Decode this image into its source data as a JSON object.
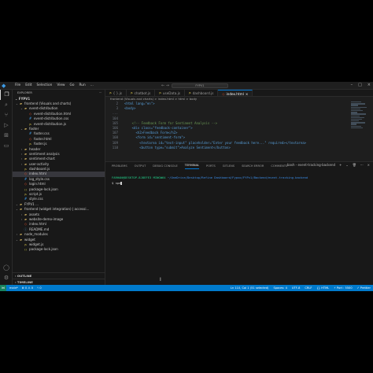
{
  "titlebar": {
    "menu": [
      "File",
      "Edit",
      "Selection",
      "View",
      "Go",
      "Run",
      "..."
    ],
    "search": "FYPV1"
  },
  "sidebar": {
    "header": "EXPLORER",
    "project": "FYPV1",
    "items": [
      {
        "label": "frontend (Visuals and charts)",
        "type": "folder",
        "depth": 0,
        "open": true
      },
      {
        "label": "event-distribution",
        "type": "folder",
        "depth": 1,
        "open": true
      },
      {
        "label": "event-distribution.html",
        "type": "html",
        "depth": 2
      },
      {
        "label": "event-distribution.css",
        "type": "css",
        "depth": 2
      },
      {
        "label": "event-distribution.js",
        "type": "js",
        "depth": 2
      },
      {
        "label": "footer",
        "type": "folder",
        "depth": 1,
        "open": true
      },
      {
        "label": "footer.css",
        "type": "css",
        "depth": 2
      },
      {
        "label": "footer.html",
        "type": "html",
        "depth": 2
      },
      {
        "label": "footer.js",
        "type": "js",
        "depth": 2
      },
      {
        "label": "header",
        "type": "folder",
        "depth": 1,
        "open": false
      },
      {
        "label": "sentiment analysis",
        "type": "folder",
        "depth": 1,
        "open": false
      },
      {
        "label": "sentiment-chart",
        "type": "folder",
        "depth": 1,
        "open": false
      },
      {
        "label": "user-activity",
        "type": "folder",
        "depth": 1,
        "open": false
      },
      {
        "label": "dashboard.js",
        "type": "js",
        "depth": 1
      },
      {
        "label": "index.html",
        "type": "html",
        "depth": 1,
        "selected": true
      },
      {
        "label": "log_style.css",
        "type": "css",
        "depth": 1
      },
      {
        "label": "login.html",
        "type": "html",
        "depth": 1
      },
      {
        "label": "package-lock.json",
        "type": "json",
        "depth": 1
      },
      {
        "label": "script.js",
        "type": "js",
        "depth": 1
      },
      {
        "label": "style.css",
        "type": "css",
        "depth": 1
      },
      {
        "label": "FYPV1 ...",
        "type": "folder",
        "depth": 0,
        "open": true
      },
      {
        "label": "frontend (widget integration) | accessi...",
        "type": "folder",
        "depth": 0,
        "open": true
      },
      {
        "label": "assets",
        "type": "folder",
        "depth": 1,
        "open": false
      },
      {
        "label": "website-demo-image",
        "type": "folder",
        "depth": 1,
        "open": false
      },
      {
        "label": "index.html",
        "type": "html",
        "depth": 1
      },
      {
        "label": "README.md",
        "type": "md",
        "depth": 1
      },
      {
        "label": "node_modules",
        "type": "folder",
        "depth": 0,
        "open": false
      },
      {
        "label": "widget",
        "type": "folder",
        "depth": 0,
        "open": true
      },
      {
        "label": "widget.js",
        "type": "js",
        "depth": 1
      },
      {
        "label": "package-lock.json",
        "type": "json",
        "depth": 1
      }
    ],
    "outline": "OUTLINE",
    "timeline": "TIMELINE"
  },
  "editor": {
    "tabs": [
      {
        "label": "{ }.js",
        "type": "js"
      },
      {
        "label": "chatbot.js",
        "type": "js"
      },
      {
        "label": "useData.js",
        "type": "js"
      },
      {
        "label": "dashboard.js",
        "type": "js"
      },
      {
        "label": "index.html",
        "type": "html",
        "active": true
      }
    ],
    "breadcrumb": "frontend (Visuals and charts) > index.html > html > body",
    "lines": [
      {
        "n": "2",
        "text": "<html lang=\"en\">"
      },
      {
        "n": "3",
        "text": "<body>"
      },
      {
        "n": "...",
        "text": ""
      },
      {
        "n": "104",
        "text": ""
      },
      {
        "n": "105",
        "text": "    <!-- Feedback Form for Sentiment Analysis -->"
      },
      {
        "n": "106",
        "text": "    <div class=\"feedback-container\">"
      },
      {
        "n": "107",
        "text": "      <h2>Feedback Form</h2>"
      },
      {
        "n": "108",
        "text": "      <form id=\"sentiment-form\">"
      },
      {
        "n": "109",
        "text": "        <textarea id=\"text-input\" placeholder=\"Enter your feedback here...\" required></textarea>"
      },
      {
        "n": "110",
        "text": "        <button type=\"submit\">Analyze Sentiment</button>"
      }
    ]
  },
  "panel": {
    "tabs": [
      "PROBLEMS",
      "OUTPUT",
      "DEBUG CONSOLE",
      "TERMINAL",
      "PORTS",
      "GITLENS",
      "SEARCH ERROR",
      "COMMENTS"
    ],
    "active_tab": "TERMINAL",
    "shell": "bash - event-tracking-backend",
    "prompt_user": "FARHAN@DESKTOP-8J8EFE3 MINGW64",
    "prompt_path": "~/OneDrive/Desktop/Refine Dashboard/Fypvo/FYPv1/Backend/event-tracking-backend",
    "prompt_symbol": "$ npm"
  },
  "statusbar": {
    "left": [
      "main*",
      "⊗ 0 ⚠ 0",
      "⑂ 0"
    ],
    "right": [
      "Ln 110, Col 1 (51 selected)",
      "Spaces: 4",
      "UTF-8",
      "CRLF",
      "{} HTML",
      "⚡ Port : 5500",
      "✓ Prettier"
    ]
  },
  "colors": {
    "accent": "#007acc",
    "editor_bg": "#1e1e1e",
    "sidebar_bg": "#181818"
  }
}
